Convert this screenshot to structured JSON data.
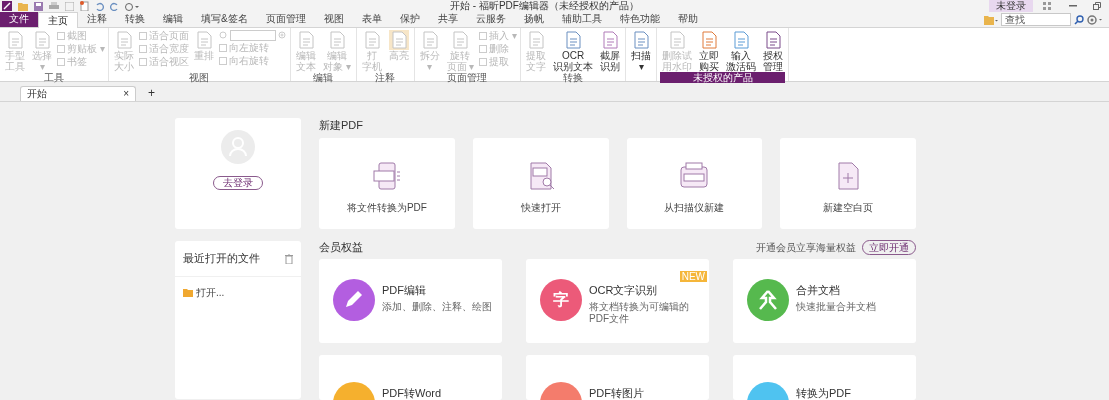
{
  "window": {
    "title": "开始 - 福昕PDF编辑器（未经授权的产品）",
    "login_status": "未登录"
  },
  "menu_tabs": [
    {
      "label": "文件",
      "kind": "file",
      "selected": false
    },
    {
      "label": "主页",
      "kind": "tab",
      "selected": true
    },
    {
      "label": "注释",
      "kind": "tab",
      "selected": false
    },
    {
      "label": "转换",
      "kind": "tab",
      "selected": false
    },
    {
      "label": "编辑",
      "kind": "tab",
      "selected": false
    },
    {
      "label": "填写&签名",
      "kind": "tab",
      "selected": false
    },
    {
      "label": "页面管理",
      "kind": "tab",
      "selected": false
    },
    {
      "label": "视图",
      "kind": "tab",
      "selected": false
    },
    {
      "label": "表单",
      "kind": "tab",
      "selected": false
    },
    {
      "label": "保护",
      "kind": "tab",
      "selected": false
    },
    {
      "label": "共享",
      "kind": "tab",
      "selected": false
    },
    {
      "label": "云服务",
      "kind": "tab",
      "selected": false
    },
    {
      "label": "扬帆",
      "kind": "tab",
      "selected": false
    },
    {
      "label": "辅助工具",
      "kind": "tab",
      "selected": false
    },
    {
      "label": "特色功能",
      "kind": "tab",
      "selected": false
    },
    {
      "label": "帮助",
      "kind": "tab",
      "selected": false
    }
  ],
  "search": {
    "placeholder": "查找"
  },
  "ribbon_groups": [
    {
      "label": "工具",
      "highlighted": false,
      "items": [
        {
          "kind": "large",
          "lines": [
            "手型",
            "工具"
          ],
          "disabled": true,
          "highlighted": false
        },
        {
          "kind": "large",
          "lines": [
            "选择",
            "▾"
          ],
          "disabled": true,
          "highlighted": false
        },
        {
          "kind": "small",
          "entries": [
            {
              "label": "截图",
              "disabled": true
            },
            {
              "label": "剪贴板 ▾",
              "disabled": true
            },
            {
              "label": "书签",
              "disabled": true
            }
          ]
        }
      ]
    },
    {
      "label": "视图",
      "highlighted": false,
      "items": [
        {
          "kind": "large",
          "lines": [
            "实际",
            "大小"
          ],
          "disabled": true,
          "highlighted": false
        },
        {
          "kind": "small",
          "entries": [
            {
              "label": "适合页面",
              "disabled": true
            },
            {
              "label": "适合宽度",
              "disabled": true
            },
            {
              "label": "适合视区",
              "disabled": true
            }
          ]
        },
        {
          "kind": "large",
          "lines": [
            "重排"
          ],
          "disabled": true,
          "highlighted": false
        },
        {
          "kind": "zoom",
          "entries": [
            {
              "label": "向左旋转",
              "disabled": true
            },
            {
              "label": "向右旋转",
              "disabled": true
            }
          ]
        }
      ]
    },
    {
      "label": "编辑",
      "highlighted": false,
      "items": [
        {
          "kind": "large",
          "lines": [
            "编辑",
            "文本"
          ],
          "disabled": true,
          "highlighted": false
        },
        {
          "kind": "large",
          "lines": [
            "编辑",
            "对象 ▾"
          ],
          "disabled": true,
          "highlighted": false
        }
      ]
    },
    {
      "label": "注释",
      "highlighted": false,
      "items": [
        {
          "kind": "large",
          "lines": [
            "打",
            "字机"
          ],
          "disabled": true,
          "highlighted": false
        },
        {
          "kind": "large",
          "lines": [
            "高亮"
          ],
          "disabled": true,
          "highlighted": true
        }
      ]
    },
    {
      "label": "页面管理",
      "highlighted": false,
      "items": [
        {
          "kind": "large",
          "lines": [
            "拆分",
            "▾"
          ],
          "disabled": true,
          "highlighted": false
        },
        {
          "kind": "large",
          "lines": [
            "旋转",
            "页面 ▾"
          ],
          "disabled": true,
          "highlighted": false
        },
        {
          "kind": "small",
          "entries": [
            {
              "label": "插入 ▾",
              "disabled": true
            },
            {
              "label": "删除",
              "disabled": true
            },
            {
              "label": "提取",
              "disabled": true
            }
          ]
        }
      ]
    },
    {
      "label": "转换",
      "highlighted": false,
      "items": [
        {
          "kind": "large",
          "lines": [
            "提取",
            "文字"
          ],
          "disabled": true,
          "highlighted": false
        },
        {
          "kind": "large",
          "lines": [
            "OCR",
            "识别文本"
          ],
          "disabled": false,
          "highlighted": false
        },
        {
          "kind": "large",
          "lines": [
            "截屏",
            "识别"
          ],
          "disabled": false,
          "highlighted": false
        }
      ]
    },
    {
      "items": [
        {
          "kind": "large",
          "lines": [
            "扫描",
            "▾"
          ],
          "disabled": false,
          "highlighted": false
        }
      ]
    },
    {
      "label": "未授权的产品",
      "highlighted": true,
      "items": [
        {
          "kind": "large",
          "lines": [
            "删除试",
            "用水印"
          ],
          "disabled": true,
          "highlighted": false
        },
        {
          "kind": "large",
          "lines": [
            "立即",
            "购买"
          ],
          "disabled": false,
          "highlighted": false
        },
        {
          "kind": "large",
          "lines": [
            "输入",
            "激活码"
          ],
          "disabled": false,
          "highlighted": false
        },
        {
          "kind": "large",
          "lines": [
            "授权",
            "管理"
          ],
          "disabled": false,
          "highlighted": false
        }
      ]
    }
  ],
  "doc_tabs": [
    {
      "label": "开始",
      "close": "×",
      "selected": true
    }
  ],
  "new_tab": "+",
  "login_card": {
    "button": "去登录"
  },
  "recent_files": {
    "title": "最近打开的文件",
    "items": [
      {
        "label": "打开..."
      }
    ]
  },
  "new_pdf": {
    "title": "新建PDF",
    "cards": [
      {
        "label": "将文件转换为PDF"
      },
      {
        "label": "快速打开"
      },
      {
        "label": "从扫描仪新建"
      },
      {
        "label": "新建空白页"
      }
    ]
  },
  "membership": {
    "title": "会员权益",
    "promo": "开通会员立享海量权益",
    "button": "立即开通",
    "cards": [
      {
        "title": "PDF编辑",
        "desc": "添加、删除、注释、绘图",
        "color": "#b35ee0"
      },
      {
        "title": "OCR文字识别",
        "desc": "将文档转换为可编辑的PDF文件",
        "color": "#ec5a79",
        "badge": "NEW",
        "icon_text": "字"
      },
      {
        "title": "合并文档",
        "desc": "快速批量合并文档",
        "color": "#56b94e"
      },
      {
        "title": "PDF转Word",
        "color": "#f5b02e"
      },
      {
        "title": "PDF转图片",
        "color": "#f47c6c"
      },
      {
        "title": "转换为PDF",
        "color": "#4fc3f0"
      }
    ]
  }
}
